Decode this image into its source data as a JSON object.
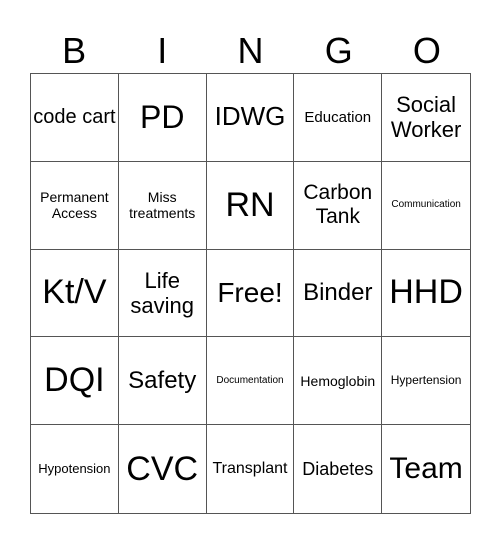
{
  "header": {
    "letters": [
      "B",
      "I",
      "N",
      "G",
      "O"
    ]
  },
  "cells": [
    {
      "text": "code cart",
      "size": 20
    },
    {
      "text": "PD",
      "size": 32
    },
    {
      "text": "IDWG",
      "size": 26
    },
    {
      "text": "Education",
      "size": 15
    },
    {
      "text": "Social Worker",
      "size": 22
    },
    {
      "text": "Permanent Access",
      "size": 14
    },
    {
      "text": "Miss treatments",
      "size": 14
    },
    {
      "text": "RN",
      "size": 34
    },
    {
      "text": "Carbon Tank",
      "size": 21
    },
    {
      "text": "Communication",
      "size": 10
    },
    {
      "text": "Kt/V",
      "size": 34
    },
    {
      "text": "Life saving",
      "size": 22
    },
    {
      "text": "Free!",
      "size": 28
    },
    {
      "text": "Binder",
      "size": 24
    },
    {
      "text": "HHD",
      "size": 34
    },
    {
      "text": "DQI",
      "size": 34
    },
    {
      "text": "Safety",
      "size": 24
    },
    {
      "text": "Documentation",
      "size": 10
    },
    {
      "text": "Hemoglobin",
      "size": 14
    },
    {
      "text": "Hypertension",
      "size": 12
    },
    {
      "text": "Hypotension",
      "size": 13
    },
    {
      "text": "CVC",
      "size": 34
    },
    {
      "text": "Transplant",
      "size": 16
    },
    {
      "text": "Diabetes",
      "size": 18
    },
    {
      "text": "Team",
      "size": 30
    }
  ]
}
